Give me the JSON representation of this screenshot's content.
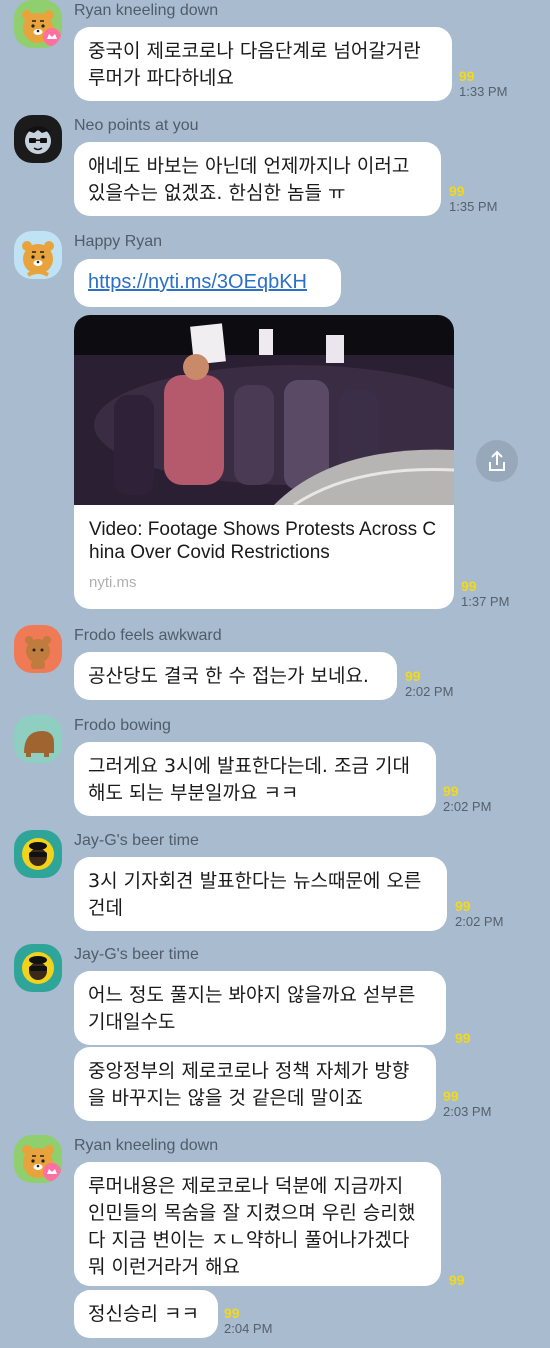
{
  "colors": {
    "background": "#a9bbce",
    "bubble": "#ffffff",
    "unread": "#f2d91a",
    "link": "#2b6fc7"
  },
  "messages": [
    {
      "sender": "Ryan kneeling down",
      "avatar_icon": "ryan-crown-avatar",
      "text": "중국이 제로코로나 다음단계로 넘어갈거란\n루머가 파다하네요",
      "unread": "99",
      "time": "1:33 PM"
    },
    {
      "sender": "Neo points at you",
      "avatar_icon": "neo-avatar",
      "text": "애네도 바보는 아닌데 언제까지나 이러고\n있을수는 없겠죠. 한심한 놈들 ㅠ",
      "unread": "99",
      "time": "1:35 PM"
    },
    {
      "sender": "Happy Ryan",
      "avatar_icon": "happy-ryan-avatar",
      "link": "https://nyti.ms/3OEqbKH",
      "card": {
        "title": "Video: Footage Shows Protests Across China Over Covid Restrictions",
        "domain": "nyti.ms",
        "image_icon": "protest-photo"
      },
      "unread": "99",
      "time": "1:37 PM"
    },
    {
      "sender": "Frodo feels awkward",
      "avatar_icon": "frodo-avatar",
      "text": "공산당도 결국 한 수 접는가 보네요.",
      "unread": "99",
      "time": "2:02 PM"
    },
    {
      "sender": "Frodo bowing",
      "avatar_icon": "frodo-bowing-avatar",
      "text": "그러게요 3시에 발표한다는데. 조금 기대\n해도 되는 부분일까요 ㅋㅋ",
      "unread": "99",
      "time": "2:02 PM"
    },
    {
      "sender": "Jay-G's beer time",
      "avatar_icon": "jay-g-avatar",
      "text": "3시 기자회견 발표한다는 뉴스때문에 오른\n건데",
      "unread": "99",
      "time": "2:02 PM"
    },
    {
      "sender": "Jay-G's beer time",
      "avatar_icon": "jay-g-avatar",
      "text": "어느 정도 풀지는 봐야지 않을까요 섣부른\n기대일수도",
      "unread": "99",
      "text2": "중앙정부의 제로코로나 정책 자체가 방향\n을 바꾸지는 않을 것 같은데 말이죠",
      "unread2": "99",
      "time2": "2:03 PM"
    },
    {
      "sender": "Ryan kneeling down",
      "avatar_icon": "ryan-crown-avatar",
      "text": "루머내용은 제로코로나 덕분에 지금까지\n인민들의 목숨을 잘 지켰으며 우린 승리했\n다 지금 변이는 ㅈㄴ약하니 풀어나가겠다\n뭐 이런거라거 해요",
      "unread": "99",
      "text2": "정신승리 ㅋㅋ",
      "unread2": "99",
      "time2": "2:04 PM"
    }
  ],
  "share_icon": "share-icon"
}
